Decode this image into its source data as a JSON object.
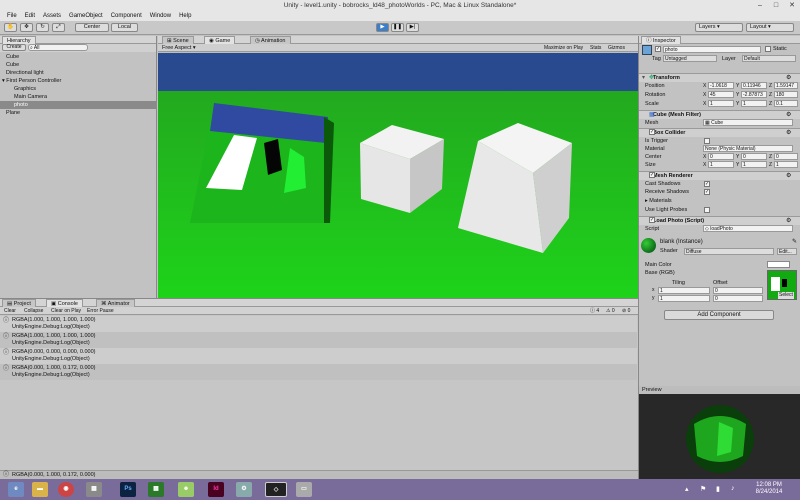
{
  "window": {
    "title": "Unity - level1.unity - bobrocks_ld48_photoWorlds - PC, Mac & Linux Standalone*"
  },
  "menu": [
    "File",
    "Edit",
    "Assets",
    "GameObject",
    "Component",
    "Window",
    "Help"
  ],
  "toolbar": {
    "pivot": "Center",
    "space": "Local",
    "layers": "Layers",
    "layout": "Layout"
  },
  "hierarchy": {
    "tab": "Hierarchy",
    "create": "Create",
    "search_placeholder": "All",
    "items": [
      "Cube",
      "Cube",
      "Directional light",
      "First Person Controller",
      "Graphics",
      "Main Camera",
      "photo",
      "Plane"
    ]
  },
  "game": {
    "tabs": [
      "Scene",
      "Game",
      "Animation"
    ],
    "aspect": "Free Aspect",
    "right_buttons": [
      "Maximize on Play",
      "Stats",
      "Gizmos"
    ]
  },
  "inspector": {
    "tab": "Inspector",
    "name": "photo",
    "static": "Static",
    "tag_label": "Tag",
    "tag": "Untagged",
    "layer_label": "Layer",
    "layer": "Default",
    "transform": {
      "title": "Transform",
      "position": {
        "label": "Position",
        "x": "-1.0618",
        "y": "0.11946",
        "z": "1.59147"
      },
      "rotation": {
        "label": "Rotation",
        "x": "45",
        "y": "-2.87873",
        "z": "180"
      },
      "scale": {
        "label": "Scale",
        "x": "1",
        "y": "1",
        "z": "0.1"
      }
    },
    "mesh_filter": {
      "title": "Cube (Mesh Filter)",
      "mesh_label": "Mesh",
      "mesh": "Cube"
    },
    "box_collider": {
      "title": "Box Collider",
      "is_trigger": "Is Trigger",
      "material_label": "Material",
      "material": "None (Physic Material)",
      "center": {
        "label": "Center",
        "x": "0",
        "y": "0",
        "z": "0"
      },
      "size": {
        "label": "Size",
        "x": "1",
        "y": "1",
        "z": "1"
      }
    },
    "mesh_renderer": {
      "title": "Mesh Renderer",
      "cast_shadows": "Cast Shadows",
      "receive_shadows": "Receive Shadows",
      "materials": "Materials",
      "use_light_probes": "Use Light Probes"
    },
    "script_comp": {
      "title": "Load Photo (Script)",
      "script_label": "Script",
      "script": "loadPhoto"
    },
    "material": {
      "name": "blank (Instance)",
      "shader_label": "Shader",
      "shader": "Diffuse",
      "edit": "Edit...",
      "main_color": "Main Color",
      "base": "Base (RGB)",
      "tiling": "Tiling",
      "offset": "Offset",
      "tx": "1",
      "ty": "1",
      "ox": "0",
      "oy": "0",
      "select": "Select"
    },
    "add_component": "Add Component",
    "preview": "Preview"
  },
  "console": {
    "tabs": [
      "Project",
      "Console",
      "Animator"
    ],
    "buttons": [
      "Clear",
      "Collapse",
      "Clear on Play",
      "Error Pause"
    ],
    "counts": [
      "4",
      "0",
      "0"
    ],
    "entries": [
      {
        "line1": "RGBA(1.000, 1.000, 1.000, 1.000)",
        "line2": "UnityEngine.Debug:Log(Object)"
      },
      {
        "line1": "RGBA(1.000, 1.000, 1.000, 1.000)",
        "line2": "UnityEngine.Debug:Log(Object)"
      },
      {
        "line1": "RGBA(0.000, 0.000, 0.000, 0.000)",
        "line2": "UnityEngine.Debug:Log(Object)"
      },
      {
        "line1": "RGBA(0.000, 1.000, 0.172, 0.000)",
        "line2": "UnityEngine.Debug:Log(Object)"
      }
    ],
    "status": "RGBA(0.000, 1.000, 0.172, 0.000)"
  },
  "taskbar": {
    "time": "12:08 PM",
    "date": "8/24/2014",
    "apps": [
      "Ps",
      "Id"
    ]
  },
  "colors": {
    "sky": "#2a4a8f",
    "ground": "#1fc21f",
    "accent": "#3c7fc8"
  }
}
